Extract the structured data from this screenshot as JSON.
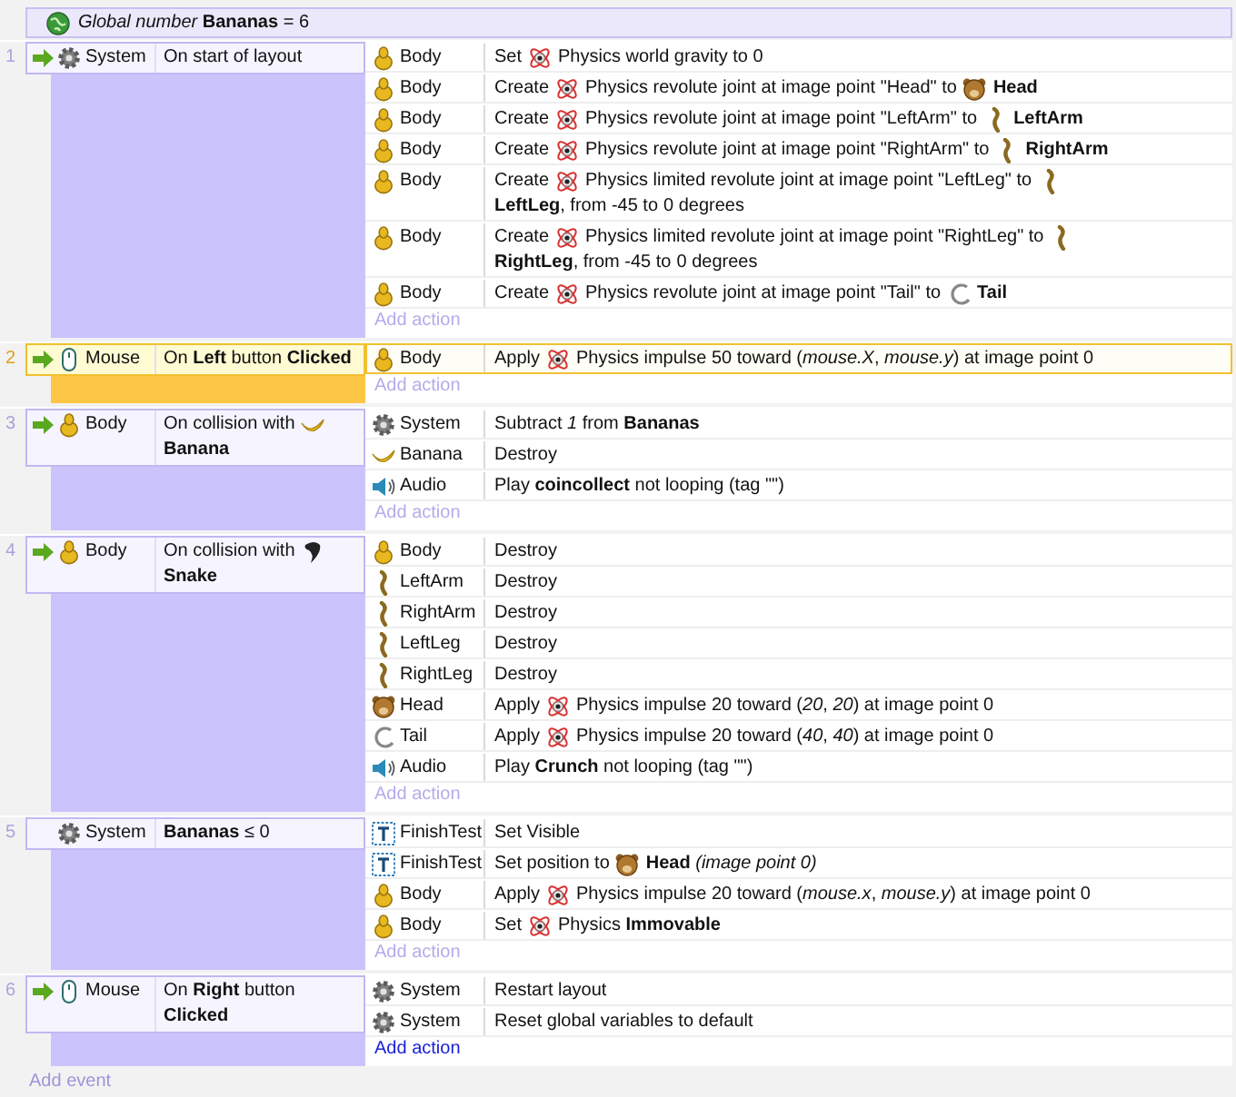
{
  "global_variable": {
    "text": "*Global number* **Bananas** = 6"
  },
  "events": [
    {
      "number": "1",
      "selected": false,
      "trigger": true,
      "condition": {
        "object": "System",
        "kind": "gear",
        "text": [
          "On start of layout"
        ]
      },
      "actions": [
        {
          "object": "Body",
          "kind": "body",
          "text": [
            "Set",
            {
              "kind": "physics"
            },
            "Physics world gravity to 0"
          ]
        },
        {
          "object": "Body",
          "kind": "body",
          "text": [
            "Create",
            {
              "kind": "physics"
            },
            "Physics revolute joint at image point \"Head\" to",
            {
              "kind": "head"
            },
            "**Head**"
          ]
        },
        {
          "object": "Body",
          "kind": "body",
          "text": [
            "Create",
            {
              "kind": "physics"
            },
            "Physics revolute joint at image point \"LeftArm\" to",
            {
              "kind": "limb"
            },
            "**LeftArm**"
          ]
        },
        {
          "object": "Body",
          "kind": "body",
          "text": [
            "Create",
            {
              "kind": "physics"
            },
            "Physics revolute joint at image point \"RightArm\" to",
            {
              "kind": "limb"
            },
            "**RightArm**"
          ]
        },
        {
          "object": "Body",
          "kind": "body",
          "text": [
            "Create",
            {
              "kind": "physics"
            },
            "Physics limited revolute joint at image point \"LeftLeg\" to",
            {
              "kind": "limb"
            },
            "**LeftLeg**, from -45 to",
            "0 degrees"
          ]
        },
        {
          "object": "Body",
          "kind": "body",
          "text": [
            "Create",
            {
              "kind": "physics"
            },
            "Physics limited revolute joint at image point \"RightLeg\" to",
            {
              "kind": "limb"
            },
            "**RightLeg**, from -45 to",
            "0 degrees"
          ]
        },
        {
          "object": "Body",
          "kind": "body",
          "text": [
            "Create",
            {
              "kind": "physics"
            },
            "Physics revolute joint at image point \"Tail\" to",
            {
              "kind": "tail"
            },
            "**Tail**"
          ]
        }
      ],
      "add_action": {
        "label": "Add action",
        "highlighted": false
      }
    },
    {
      "number": "2",
      "selected": true,
      "trigger": true,
      "condition": {
        "object": "Mouse",
        "kind": "mouse",
        "text": [
          "On **Left** button **Clicked**"
        ]
      },
      "actions": [
        {
          "object": "Body",
          "kind": "body",
          "text": [
            "Apply",
            {
              "kind": "physics"
            },
            "Physics impulse 50 toward (*mouse.X*, *mouse.y*) at image point 0"
          ]
        }
      ],
      "add_action": {
        "label": "Add action",
        "highlighted": false
      }
    },
    {
      "number": "3",
      "selected": false,
      "trigger": true,
      "condition": {
        "object": "Body",
        "kind": "body",
        "text": [
          "On collision with",
          {
            "kind": "banana"
          },
          "**Banana**"
        ]
      },
      "actions": [
        {
          "object": "System",
          "kind": "gear",
          "text": [
            "Subtract *1* from **Bananas**"
          ]
        },
        {
          "object": "Banana",
          "kind": "banana",
          "text": [
            "Destroy"
          ]
        },
        {
          "object": "Audio",
          "kind": "speaker",
          "text": [
            "Play **coincollect** not looping (tag \"\")"
          ]
        }
      ],
      "add_action": {
        "label": "Add action",
        "highlighted": false
      }
    },
    {
      "number": "4",
      "selected": false,
      "trigger": true,
      "condition": {
        "object": "Body",
        "kind": "body",
        "text": [
          "On collision with",
          {
            "kind": "snake"
          },
          "**Snake**"
        ]
      },
      "actions": [
        {
          "object": "Body",
          "kind": "body",
          "text": [
            "Destroy"
          ]
        },
        {
          "object": "LeftArm",
          "kind": "limb",
          "text": [
            "Destroy"
          ]
        },
        {
          "object": "RightArm",
          "kind": "limb",
          "text": [
            "Destroy"
          ]
        },
        {
          "object": "LeftLeg",
          "kind": "limb",
          "text": [
            "Destroy"
          ]
        },
        {
          "object": "RightLeg",
          "kind": "limb",
          "text": [
            "Destroy"
          ]
        },
        {
          "object": "Head",
          "kind": "head",
          "text": [
            "Apply",
            {
              "kind": "physics"
            },
            "Physics impulse 20 toward (*20*, *20*) at image point 0"
          ]
        },
        {
          "object": "Tail",
          "kind": "tail",
          "text": [
            "Apply",
            {
              "kind": "physics"
            },
            "Physics impulse 20 toward (*40*, *40*) at image point 0"
          ]
        },
        {
          "object": "Audio",
          "kind": "speaker",
          "text": [
            "Play **Crunch** not looping (tag \"\")"
          ]
        }
      ],
      "add_action": {
        "label": "Add action",
        "highlighted": false
      }
    },
    {
      "number": "5",
      "selected": false,
      "trigger": false,
      "condition": {
        "object": "System",
        "kind": "gear",
        "text": [
          "**Bananas** ≤ 0"
        ]
      },
      "actions": [
        {
          "object": "FinishTest",
          "kind": "text",
          "text": [
            "Set Visible"
          ]
        },
        {
          "object": "FinishTest",
          "kind": "text",
          "text": [
            "Set position to",
            {
              "kind": "head"
            },
            "**Head** *(image point 0)*"
          ]
        },
        {
          "object": "Body",
          "kind": "body",
          "text": [
            "Apply",
            {
              "kind": "physics"
            },
            "Physics impulse 20 toward (*mouse.x*, *mouse.y*) at image point 0"
          ]
        },
        {
          "object": "Body",
          "kind": "body",
          "text": [
            "Set",
            {
              "kind": "physics"
            },
            "Physics **Immovable**"
          ]
        }
      ],
      "add_action": {
        "label": "Add action",
        "highlighted": false
      }
    },
    {
      "number": "6",
      "selected": false,
      "trigger": true,
      "condition": {
        "object": "Mouse",
        "kind": "mouse",
        "text": [
          "On **Right** button",
          "**Clicked**"
        ]
      },
      "actions": [
        {
          "object": "System",
          "kind": "gear",
          "text": [
            "Restart layout"
          ]
        },
        {
          "object": "System",
          "kind": "gear",
          "text": [
            "Reset global variables to default"
          ]
        }
      ],
      "add_action": {
        "label": "Add action",
        "highlighted": true
      }
    }
  ],
  "add_event": "Add event"
}
